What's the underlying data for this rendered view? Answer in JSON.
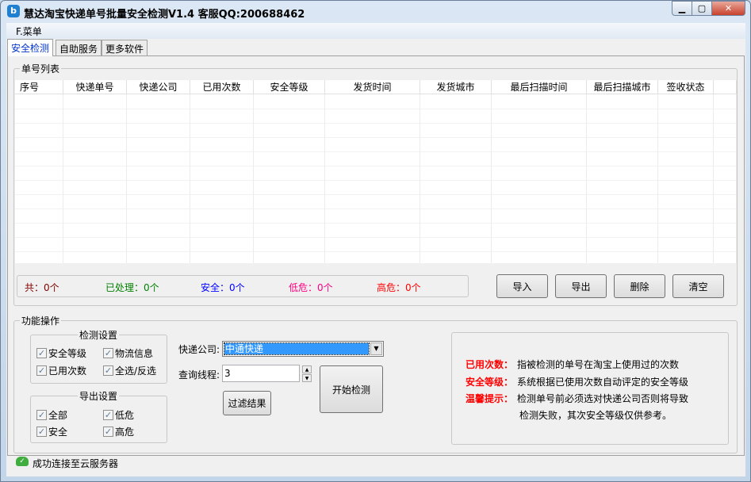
{
  "window": {
    "title": "慧达淘宝快递单号批量安全检测V1.4 客服QQ:200688462",
    "minimize": "▁",
    "maximize": "▢",
    "close": "✕"
  },
  "menu": {
    "label": "F.菜单"
  },
  "tabs": [
    {
      "label": "安全检测",
      "active": true
    },
    {
      "label": "自助服务"
    },
    {
      "label": "更多软件"
    }
  ],
  "list": {
    "legend": "单号列表",
    "columns": [
      "序号",
      "快递单号",
      "快递公司",
      "已用次数",
      "安全等级",
      "发货时间",
      "发货城市",
      "最后扫描时间",
      "最后扫描城市",
      "签收状态"
    ],
    "rows": []
  },
  "stats": {
    "total": "共：0个",
    "processed": "已处理：0个",
    "safe": "安全：0个",
    "low": "低危：0个",
    "high": "高危：0个"
  },
  "actions": {
    "import": "导入",
    "export": "导出",
    "delete": "删除",
    "clear": "清空"
  },
  "ops": {
    "legend": "功能操作",
    "detect": {
      "legend": "检测设置",
      "items": [
        {
          "label": "安全等级",
          "checked": true
        },
        {
          "label": "物流信息",
          "checked": true
        },
        {
          "label": "已用次数",
          "checked": true
        },
        {
          "label": "全选/反选",
          "checked": true
        }
      ]
    },
    "export": {
      "legend": "导出设置",
      "items": [
        {
          "label": "全部",
          "checked": true
        },
        {
          "label": "低危",
          "checked": true
        },
        {
          "label": "安全",
          "checked": true
        },
        {
          "label": "高危",
          "checked": true
        }
      ]
    },
    "company_label": "快递公司:",
    "company_value": "中通快递",
    "threads_label": "查询线程:",
    "threads_value": "3",
    "filter": "过滤结果",
    "start": "开始检测"
  },
  "info": {
    "k1": "已用次数：",
    "v1": "指被检测的单号在淘宝上使用过的次数",
    "k2": "安全等级：",
    "v2": "系统根据已使用次数自动评定的安全等级",
    "k3": "温馨提示：",
    "v3": "检测单号前必须选对快递公司否则将导致",
    "v3b": "检测失败，其次安全等级仅供参考。"
  },
  "status": {
    "text": "成功连接至云服务器"
  },
  "colors": {
    "total": "#800000",
    "processed": "#008000",
    "safe": "#0000ff",
    "low": "#ff0080",
    "high": "#ff0000"
  }
}
